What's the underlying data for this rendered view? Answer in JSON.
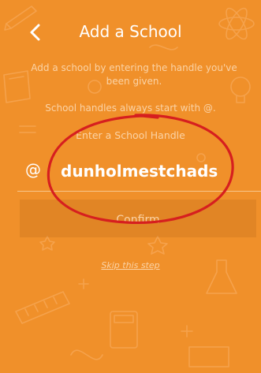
{
  "header": {
    "title": "Add a School",
    "back_icon": "chevron-left-icon"
  },
  "instructions": {
    "line": "Add a school by entering the handle you've been given.",
    "hint": "School handles always start with @."
  },
  "handle_field": {
    "label": "Enter a School Handle",
    "prefix": "@",
    "value": "dunholmestchads"
  },
  "actions": {
    "confirm_label": "Confirm",
    "skip_label": "Skip this step"
  },
  "colors": {
    "background": "#f0902a",
    "text_primary": "#ffffff",
    "text_muted": "#fbd3a6",
    "annotation_circle": "#d61f1f"
  },
  "decorations": {
    "background_pattern": "education-doodles",
    "annotation": "red-ellipse-around-handle"
  }
}
